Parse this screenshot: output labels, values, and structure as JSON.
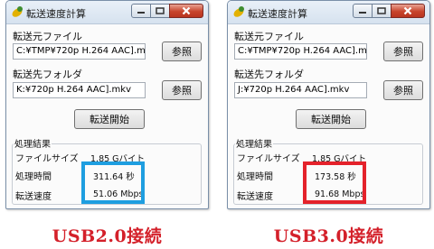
{
  "app": {
    "title": "転送速度計算",
    "src_label": "転送元ファイル",
    "dst_label": "転送先フォルダ",
    "browse_label": "参照",
    "start_label": "転送開始",
    "group_title": "処理結果",
    "file_size_label": "ファイルサイズ",
    "time_label": "処理時間",
    "speed_label": "転送速度"
  },
  "windows": [
    {
      "src_value": "C:¥TMP¥720p H.264 AAC].mkv",
      "dst_value": "K:¥720p H.264 AAC].mkv",
      "file_size": "1.85 Gバイト",
      "time": "311.64 秒",
      "speed": "51.06 Mbps",
      "highlight_color": "#1e9ee0",
      "caption": "USB2.0接続"
    },
    {
      "src_value": "C:¥TMP¥720p H.264 AAC].mkv",
      "dst_value": "J:¥720p H.264 AAC].mkv",
      "file_size": "1.85 Gバイト",
      "time": "173.58 秒",
      "speed": "91.68 Mbps",
      "highlight_color": "#e4222b",
      "caption": "USB3.0接続"
    }
  ],
  "caption_color": "#d4202a"
}
